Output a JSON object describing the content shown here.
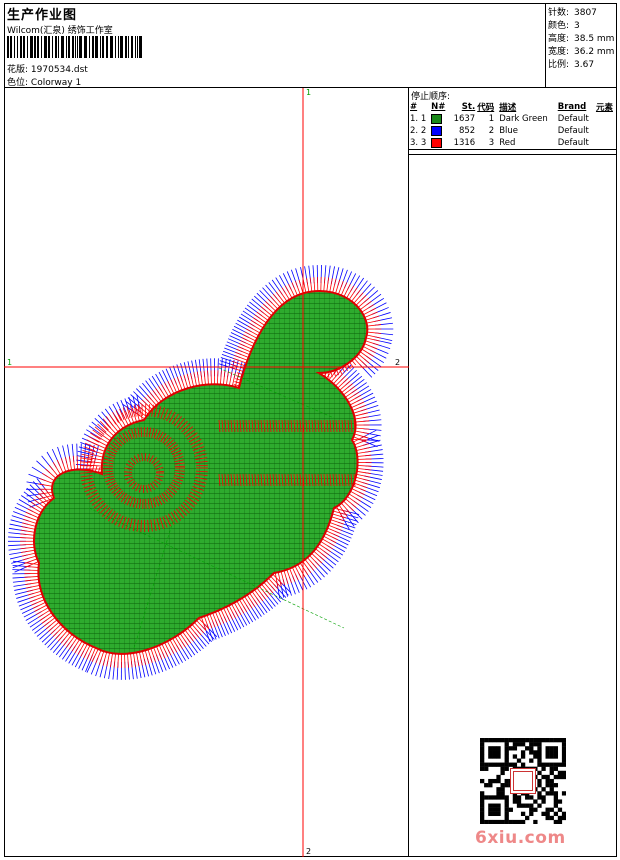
{
  "header": {
    "title": "生产作业图",
    "company": "Wilcom(汇泉) 绣饰工作室",
    "design_label": "花版:",
    "design_value": "1970534.dst",
    "colorway_label": "色位:",
    "colorway_value": "Colorway 1"
  },
  "stats": [
    {
      "label": "针数:",
      "value": "3807"
    },
    {
      "label": "颜色:",
      "value": "3"
    },
    {
      "label": "高度:",
      "value": "38.5 mm"
    },
    {
      "label": "宽度:",
      "value": "36.2 mm"
    },
    {
      "label": "比例:",
      "value": "3.67"
    }
  ],
  "canvas": {
    "axis_labels": {
      "top": "1",
      "left": "1",
      "right": "2",
      "bottom": "2"
    }
  },
  "stop_sequence": {
    "heading": "停止顺序:",
    "columns": [
      "#",
      "N#",
      "St.",
      "代码",
      "描述",
      "Brand",
      "元素"
    ],
    "rows": [
      {
        "num": "1.",
        "n": "1",
        "color": "#1a8a1a",
        "st": "1637",
        "code": "1",
        "desc": "Dark Green",
        "brand": "Default"
      },
      {
        "num": "2.",
        "n": "2",
        "color": "#0000ff",
        "st": "852",
        "code": "2",
        "desc": "Blue",
        "brand": "Default"
      },
      {
        "num": "3.",
        "n": "3",
        "color": "#ff0000",
        "st": "1316",
        "code": "3",
        "desc": "Red",
        "brand": "Default"
      }
    ]
  },
  "watermark": {
    "logo": "6xiu.com"
  },
  "colors": {
    "green": "#1a9a1a",
    "blue": "#0000ff",
    "red": "#ff0000",
    "axis": "#ff0000"
  }
}
